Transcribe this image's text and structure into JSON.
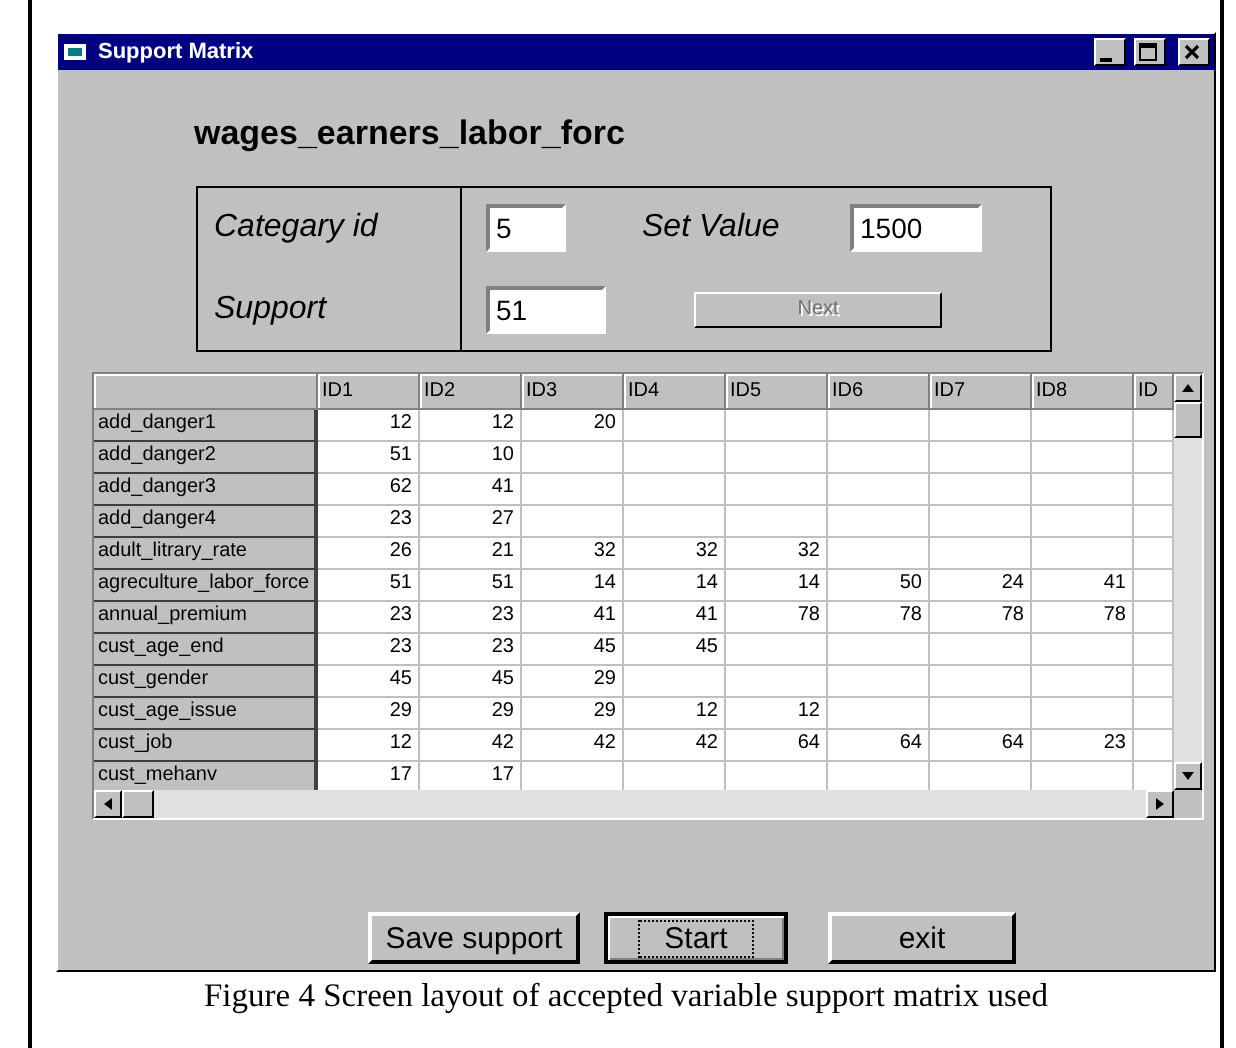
{
  "window": {
    "title": "Support Matrix"
  },
  "heading": "wages_earners_labor_forc",
  "form": {
    "category_label": "Categary id",
    "category_value": "5",
    "set_value_label": "Set Value",
    "set_value": "1500",
    "support_label": "Support",
    "support_value": "51",
    "next_button": {
      "label": "Next",
      "disabled": true
    }
  },
  "table": {
    "columns": [
      "ID1",
      "ID2",
      "ID3",
      "ID4",
      "ID5",
      "ID6",
      "ID7",
      "ID8",
      "ID"
    ],
    "rows": [
      {
        "name": "add_danger1",
        "values": [
          "12",
          "12",
          "20"
        ]
      },
      {
        "name": "add_danger2",
        "values": [
          "51",
          "10"
        ]
      },
      {
        "name": "add_danger3",
        "values": [
          "62",
          "41"
        ]
      },
      {
        "name": "add_danger4",
        "values": [
          "23",
          "27"
        ]
      },
      {
        "name": "adult_litrary_rate",
        "values": [
          "26",
          "21",
          "32",
          "32",
          "32"
        ]
      },
      {
        "name": "agreculture_labor_force",
        "values": [
          "51",
          "51",
          "14",
          "14",
          "14",
          "50",
          "24",
          "41"
        ]
      },
      {
        "name": "annual_premium",
        "values": [
          "23",
          "23",
          "41",
          "41",
          "78",
          "78",
          "78",
          "78"
        ]
      },
      {
        "name": "cust_age_end",
        "values": [
          "23",
          "23",
          "45",
          "45"
        ]
      },
      {
        "name": "cust_gender",
        "values": [
          "45",
          "45",
          "29"
        ]
      },
      {
        "name": "cust_age_issue",
        "values": [
          "29",
          "29",
          "29",
          "12",
          "12"
        ]
      },
      {
        "name": "cust_job",
        "values": [
          "12",
          "42",
          "42",
          "42",
          "64",
          "64",
          "64",
          "23"
        ]
      },
      {
        "name": "cust_mehanv",
        "values": [
          "17",
          "17"
        ]
      }
    ]
  },
  "buttons": [
    {
      "label": "Save support",
      "focused": false
    },
    {
      "label": "Start",
      "focused": true
    },
    {
      "label": "exit",
      "focused": false
    }
  ],
  "caption": "Figure 4 Screen layout of accepted variable support matrix used"
}
